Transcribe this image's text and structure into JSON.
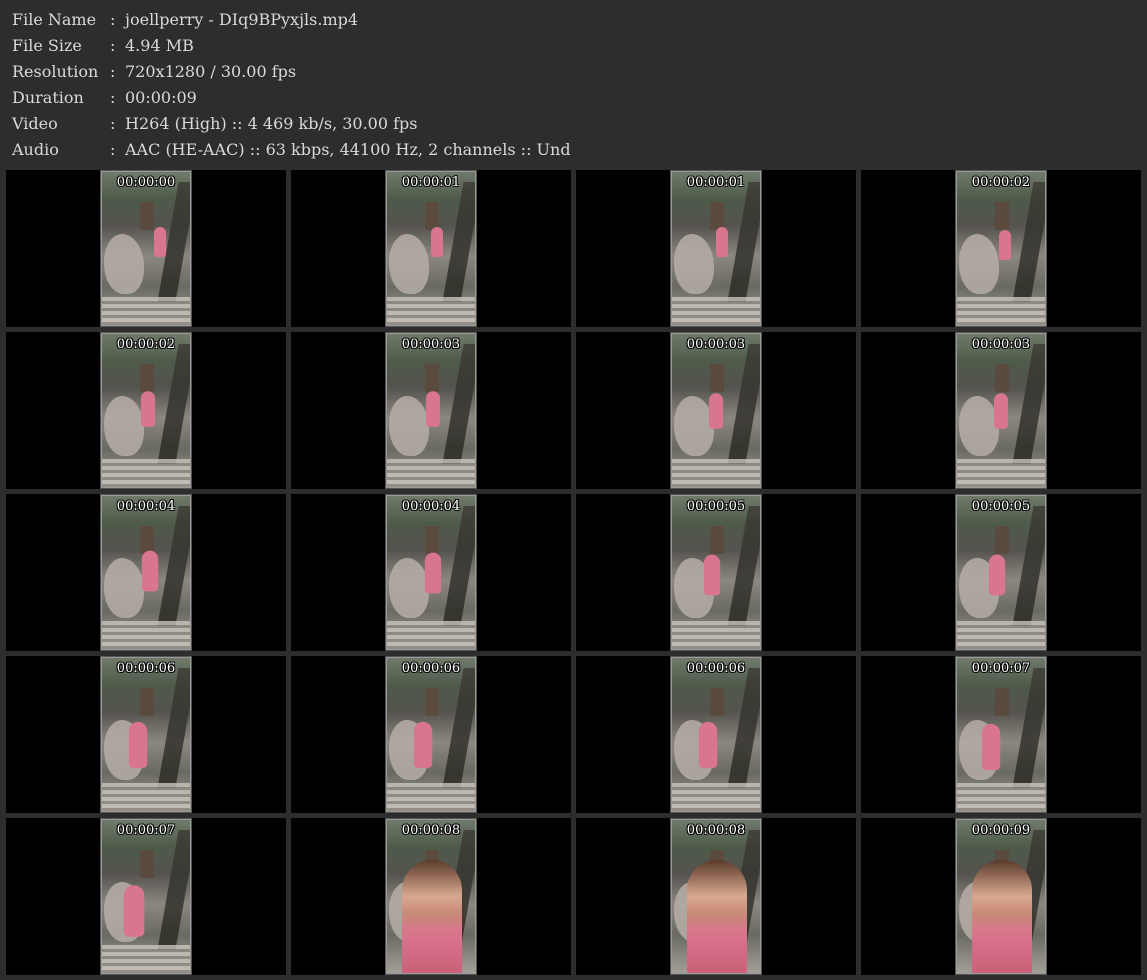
{
  "info": [
    {
      "key": "File Name",
      "colon": ":",
      "value": "joellperry - DIq9BPyxjls.mp4"
    },
    {
      "key": "File Size",
      "colon": ":",
      "value": "4.94 MB"
    },
    {
      "key": "Resolution",
      "colon": ":",
      "value": "720x1280 / 30.00 fps"
    },
    {
      "key": "Duration",
      "colon": ":",
      "value": "00:00:09"
    },
    {
      "key": "Video",
      "colon": ":",
      "value": "H264 (High) :: 4 469 kb/s, 30.00 fps"
    },
    {
      "key": "Audio",
      "colon": ":",
      "value": "AAC (HE-AAC) :: 63 kbps, 44100 Hz, 2 channels :: Und"
    }
  ],
  "thumbnails": [
    {
      "time": "00:00:00"
    },
    {
      "time": "00:00:01"
    },
    {
      "time": "00:00:01"
    },
    {
      "time": "00:00:02"
    },
    {
      "time": "00:00:02"
    },
    {
      "time": "00:00:03"
    },
    {
      "time": "00:00:03"
    },
    {
      "time": "00:00:03"
    },
    {
      "time": "00:00:04"
    },
    {
      "time": "00:00:04"
    },
    {
      "time": "00:00:05"
    },
    {
      "time": "00:00:05"
    },
    {
      "time": "00:00:06"
    },
    {
      "time": "00:00:06"
    },
    {
      "time": "00:00:06"
    },
    {
      "time": "00:00:07"
    },
    {
      "time": "00:00:07"
    },
    {
      "time": "00:00:08"
    },
    {
      "time": "00:00:08"
    },
    {
      "time": "00:00:09"
    }
  ]
}
